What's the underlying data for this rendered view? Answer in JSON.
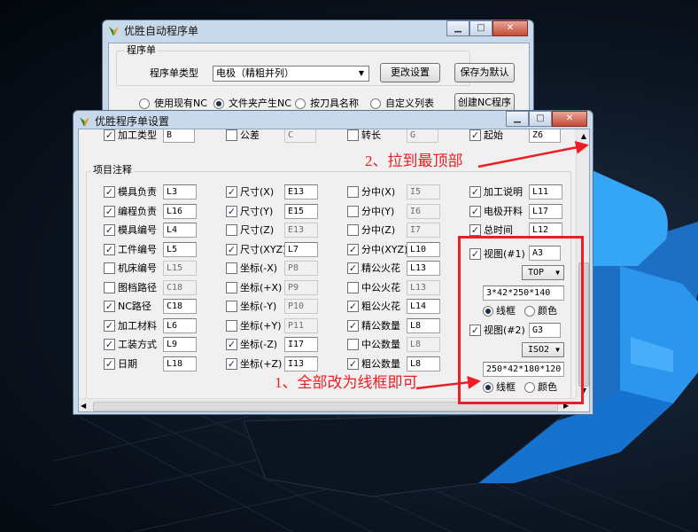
{
  "back_window": {
    "title": "优胜自动程序单",
    "group_label": "程序单",
    "type_label": "程序单类型",
    "type_select": "电极（精粗并列）",
    "change_button": "更改设置",
    "save_default_button": "保存为默认",
    "create_button": "创建NC程序",
    "radios": [
      {
        "label": "使用现有NC",
        "checked": false
      },
      {
        "label": "文件夹产生NC",
        "checked": true
      },
      {
        "label": "按刀具名称",
        "checked": false
      },
      {
        "label": "自定义列表",
        "checked": false
      }
    ]
  },
  "front_window": {
    "title": "优胜程序单设置",
    "top_row": [
      {
        "label": "加工类型",
        "value": "B",
        "checked": true
      },
      {
        "label": "公差",
        "value": "C",
        "checked": false
      },
      {
        "label": "转长",
        "value": "G",
        "checked": false
      },
      {
        "label": "起始",
        "value": "Z6",
        "checked": true
      }
    ],
    "section_label": "项目注释",
    "col1": [
      {
        "label": "模具负责",
        "checked": true,
        "value": "L3",
        "enabled": true
      },
      {
        "label": "编程负责",
        "checked": true,
        "value": "L16",
        "enabled": true
      },
      {
        "label": "模具编号",
        "checked": true,
        "value": "L4",
        "enabled": true
      },
      {
        "label": "工件编号",
        "checked": true,
        "value": "L5",
        "enabled": true
      },
      {
        "label": "机床编号",
        "checked": false,
        "value": "L15",
        "enabled": false
      },
      {
        "label": "图档路径",
        "checked": false,
        "value": "C18",
        "enabled": false
      },
      {
        "label": "NC路径",
        "checked": true,
        "value": "C18",
        "enabled": true
      },
      {
        "label": "加工材料",
        "checked": true,
        "value": "L6",
        "enabled": true
      },
      {
        "label": "工装方式",
        "checked": true,
        "value": "L9",
        "enabled": true
      },
      {
        "label": "日期",
        "checked": true,
        "value": "L18",
        "enabled": true
      }
    ],
    "col2": [
      {
        "label": "尺寸(X)",
        "checked": true,
        "value": "E13",
        "enabled": true
      },
      {
        "label": "尺寸(Y)",
        "checked": true,
        "value": "E15",
        "enabled": true
      },
      {
        "label": "尺寸(Z)",
        "checked": false,
        "value": "E13",
        "enabled": false
      },
      {
        "label": "尺寸(XYZ)",
        "checked": true,
        "value": "L7",
        "enabled": true
      },
      {
        "label": "坐标(-X)",
        "checked": false,
        "value": "P8",
        "enabled": false
      },
      {
        "label": "坐标(+X)",
        "checked": false,
        "value": "P9",
        "enabled": false
      },
      {
        "label": "坐标(-Y)",
        "checked": false,
        "value": "P10",
        "enabled": false
      },
      {
        "label": "坐标(+Y)",
        "checked": false,
        "value": "P11",
        "enabled": false
      },
      {
        "label": "坐标(-Z)",
        "checked": true,
        "value": "I17",
        "enabled": true
      },
      {
        "label": "坐标(+Z)",
        "checked": true,
        "value": "I13",
        "enabled": true
      }
    ],
    "col3": [
      {
        "label": "分中(X)",
        "checked": false,
        "value": "I5",
        "enabled": false
      },
      {
        "label": "分中(Y)",
        "checked": false,
        "value": "I6",
        "enabled": false
      },
      {
        "label": "分中(Z)",
        "checked": false,
        "value": "I7",
        "enabled": false
      },
      {
        "label": "分中(XYZ)",
        "checked": true,
        "value": "L10",
        "enabled": true
      },
      {
        "label": "精公火花",
        "checked": true,
        "value": "L13",
        "enabled": true
      },
      {
        "label": "中公火花",
        "checked": false,
        "value": "L13",
        "enabled": false
      },
      {
        "label": "粗公火花",
        "checked": true,
        "value": "L14",
        "enabled": true
      },
      {
        "label": "精公数量",
        "checked": true,
        "value": "L8",
        "enabled": true
      },
      {
        "label": "中公数量",
        "checked": false,
        "value": "L8",
        "enabled": false
      },
      {
        "label": "粗公数量",
        "checked": true,
        "value": "L8",
        "enabled": true
      }
    ],
    "col4": [
      {
        "label": "加工说明",
        "checked": true,
        "value": "L11",
        "enabled": true
      },
      {
        "label": "电极开料",
        "checked": true,
        "value": "L17",
        "enabled": true
      },
      {
        "label": "总时间",
        "checked": true,
        "value": "L12",
        "enabled": true
      }
    ],
    "view1": {
      "label": "视图(#1)",
      "checked": true,
      "value": "A3",
      "view_select": "TOP",
      "size": "3*42*250*140",
      "radio_wire": "线框",
      "radio_color": "颜色",
      "wire_selected": true
    },
    "view2": {
      "label": "视图(#2)",
      "checked": true,
      "value": "G3",
      "view_select": "ISO2",
      "size": "250*42*180*120",
      "radio_wire": "线框",
      "radio_color": "颜色",
      "wire_selected": true
    }
  },
  "annotations": {
    "a1": "1、全部改为线框即可",
    "a2": "2、拉到最顶部"
  },
  "colors": {
    "annotation": "#ee1d24",
    "window_frame": "#c9d9ec",
    "model_blue": "#1e8ae6"
  }
}
